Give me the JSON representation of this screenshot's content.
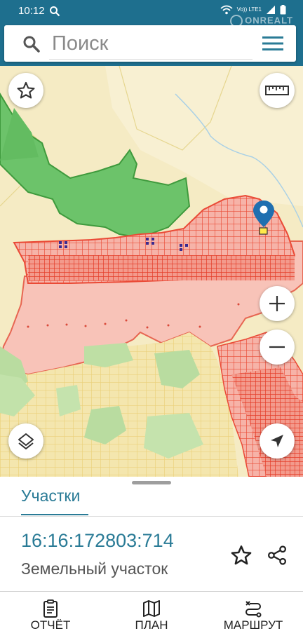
{
  "status_bar": {
    "time": "10:12",
    "network": "Vo)) LTE1",
    "watermark": "ONREALT"
  },
  "search": {
    "placeholder": "Поиск"
  },
  "icons": {
    "search": "search-icon",
    "menu": "hamburger-menu-icon",
    "favorite": "star-outline-icon",
    "ruler": "ruler-icon",
    "zoom_in": "plus-icon",
    "zoom_out": "minus-icon",
    "layers": "layers-icon",
    "locate": "navigation-arrow-icon",
    "pin": "map-pin-icon",
    "share": "share-icon",
    "report": "clipboard-icon",
    "plan": "map-icon",
    "route": "route-icon"
  },
  "colors": {
    "header": "#1e6f8e",
    "accent": "#2a7b96",
    "forest": "#5cb85c",
    "parcels": "#f47a6a",
    "pin": "#1f6fb0"
  },
  "sheet": {
    "tab_label": "Участки",
    "cadastral_number": "16:16:172803:714",
    "parcel_type": "Земельный участок"
  },
  "bottom_nav": {
    "report": "ОТЧЁТ",
    "plan": "ПЛАН",
    "route": "МАРШРУТ"
  }
}
